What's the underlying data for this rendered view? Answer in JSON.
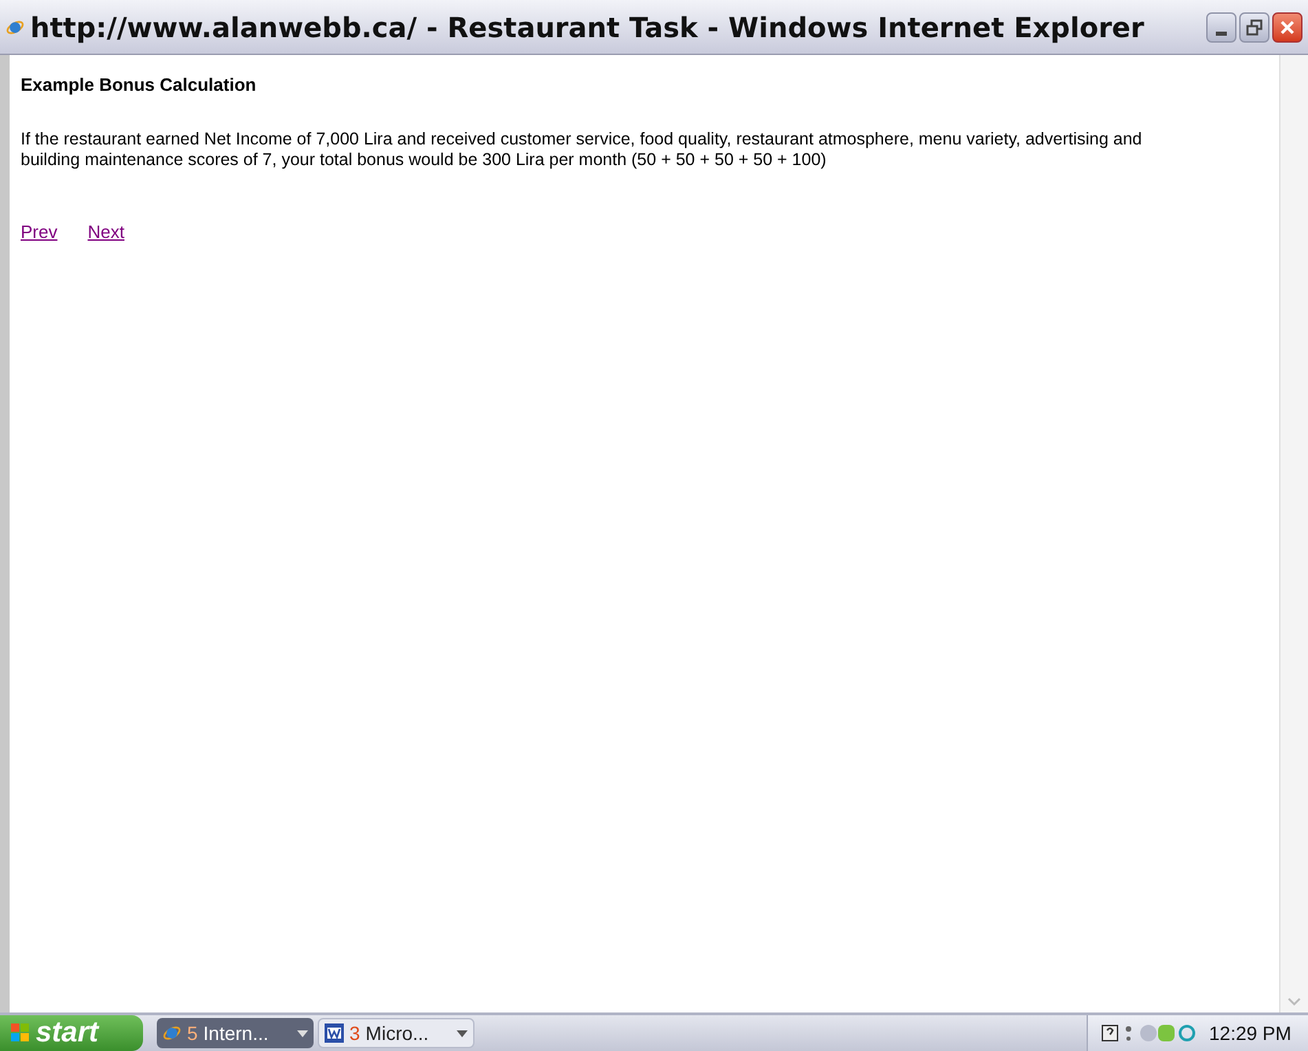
{
  "window": {
    "title": "http://www.alanwebb.ca/ - Restaurant Task - Windows Internet Explorer"
  },
  "page": {
    "heading": "Example Bonus Calculation",
    "paragraph": "If the restaurant earned Net Income of 7,000 Lira and received customer service, food quality, restaurant atmosphere, menu variety, advertising and building maintenance scores of 7, your total bonus would be 300 Lira per month (50 + 50 + 50 + 50 + 100)",
    "links": [
      "Prev",
      "Next"
    ]
  },
  "taskbar": {
    "start": "start",
    "tasks": [
      {
        "kind": "browser",
        "count": "5",
        "label": "Intern...",
        "selected": true
      },
      {
        "kind": "word",
        "count": "3",
        "label": "Micro...",
        "selected": false
      }
    ],
    "clock": "12:29 PM"
  }
}
